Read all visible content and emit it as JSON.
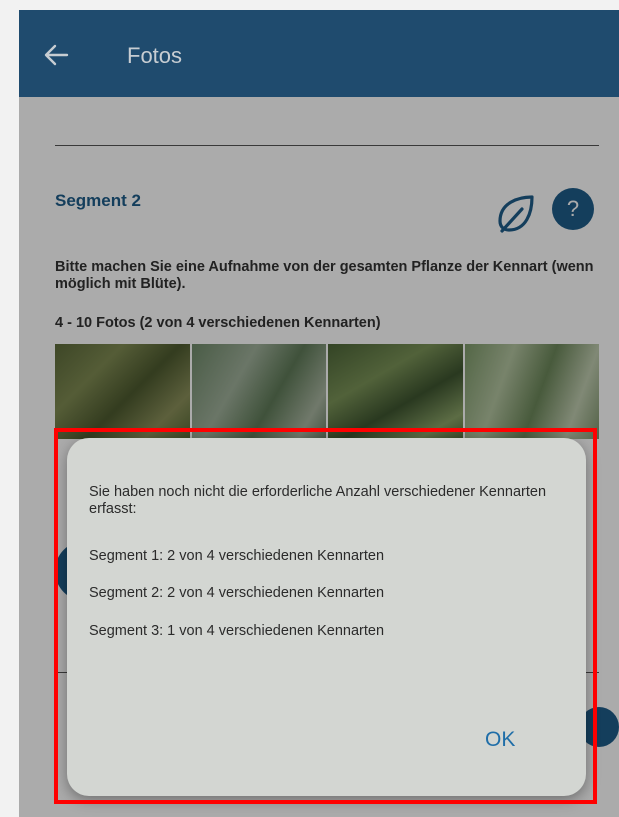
{
  "appbar": {
    "title": "Fotos",
    "back_icon": "arrow-left-icon"
  },
  "segment": {
    "title": "Segment 2",
    "instruction": "Bitte machen Sie eine Aufnahme von der gesamten Pflanze der Kennart (wenn möglich mit Blüte).",
    "photo_count": "4 - 10 Fotos  (2 von 4 verschiedenen Kennarten)",
    "leaf_icon": "leaf-icon",
    "help_label": "?",
    "photos": [
      {
        "label": ""
      },
      {
        "label": ""
      },
      {
        "label": ""
      },
      {
        "label": ""
      }
    ]
  },
  "dialog": {
    "message": "Sie haben noch nicht die erforderliche Anzahl verschiedener Kennarten erfasst:",
    "lines": [
      "Segment 1:  2 von 4 verschiedenen Kennarten",
      "Segment 2:  2 von 4 verschiedenen Kennarten",
      "Segment 3:  1 von 4 verschiedenen Kennarten"
    ],
    "ok_label": "OK"
  },
  "colors": {
    "appbar": "#1f4b6e",
    "accent": "#1f5d8a",
    "highlight": "#ff0000"
  }
}
